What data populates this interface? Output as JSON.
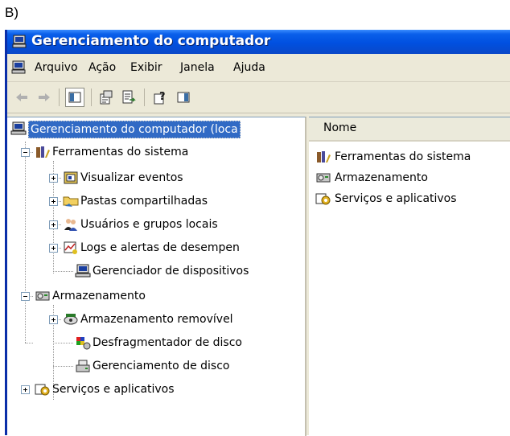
{
  "figure_label": "B)",
  "window": {
    "title": "Gerenciamento do computador"
  },
  "menu": [
    "Arquivo",
    "Ação",
    "Exibir",
    "Janela",
    "Ajuda"
  ],
  "toolbar": {
    "buttons": [
      "back-icon",
      "forward-icon",
      "show-hide-tree-icon",
      "properties-icon",
      "export-list-icon",
      "help-icon",
      "show-hide-action-pane-icon"
    ]
  },
  "tree": {
    "root": "Gerenciamento do computador (loca",
    "system_tools": "Ferramentas do sistema",
    "event_viewer": "Visualizar eventos",
    "shared_folders": "Pastas compartilhadas",
    "local_users": "Usuários e grupos locais",
    "perf_logs": "Logs e alertas de desempen",
    "device_manager": "Gerenciador de dispositivos",
    "storage": "Armazenamento",
    "removable_storage": "Armazenamento removível",
    "defragmenter": "Desfragmentador de disco",
    "disk_management": "Gerenciamento de disco",
    "services_apps": "Serviços e aplicativos"
  },
  "list": {
    "column_name": "Nome",
    "items": [
      "Ferramentas do sistema",
      "Armazenamento",
      "Serviços e aplicativos"
    ]
  },
  "colors": {
    "titlebar": "#0050e0",
    "selection": "#316ac5",
    "chrome": "#ece9d8"
  }
}
